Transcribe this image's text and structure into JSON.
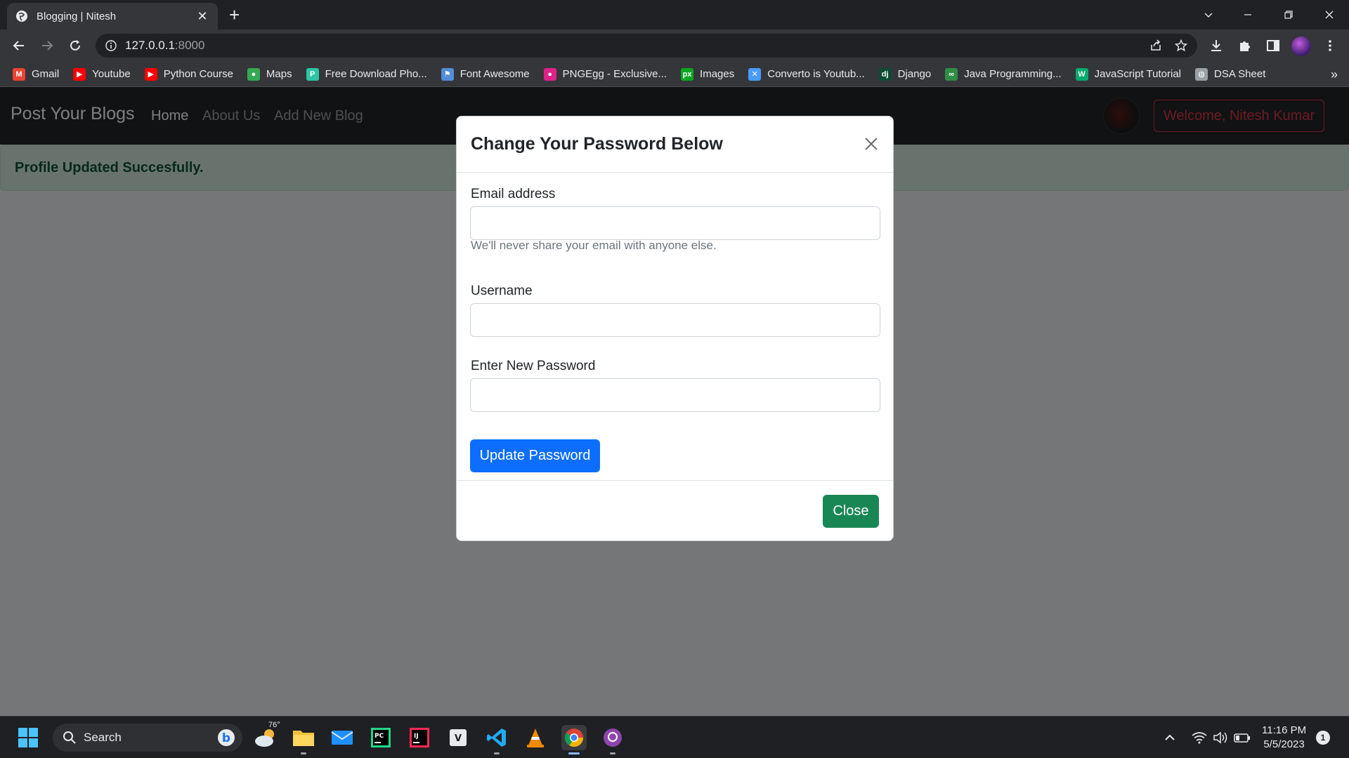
{
  "browser": {
    "tab_title": "Blogging | Nitesh",
    "url_host": "127.0.0.1",
    "url_port": ":8000",
    "bookmarks": [
      {
        "label": "Gmail",
        "icon": "gmail-icon",
        "color": "#ea4335"
      },
      {
        "label": "Youtube",
        "icon": "youtube-icon",
        "color": "#ff0000"
      },
      {
        "label": "Python Course",
        "icon": "youtube-icon",
        "color": "#ff0000"
      },
      {
        "label": "Maps",
        "icon": "maps-icon",
        "color": "#34a853"
      },
      {
        "label": "Free Download Pho...",
        "icon": "photo-site-icon",
        "color": "#2ec4a6"
      },
      {
        "label": "Font Awesome",
        "icon": "flag-icon",
        "color": "#528dd7"
      },
      {
        "label": "PNGEgg - Exclusive...",
        "icon": "pngegg-icon",
        "color": "#e0218a"
      },
      {
        "label": "Images",
        "icon": "px-icon",
        "color": "#07a81f"
      },
      {
        "label": "Converto is Youtub...",
        "icon": "converto-icon",
        "color": "#4a9bff"
      },
      {
        "label": "Django",
        "icon": "django-icon",
        "color": "#0c4b33"
      },
      {
        "label": "Java Programming...",
        "icon": "gfg-icon",
        "color": "#2f8d46"
      },
      {
        "label": "JavaScript Tutorial",
        "icon": "w3-icon",
        "color": "#04aa6d"
      },
      {
        "label": "DSA Sheet",
        "icon": "globe-icon",
        "color": "#9aa0a6"
      }
    ],
    "bookmarks_more": "»"
  },
  "navbar": {
    "brand": "Post Your Blogs",
    "links": [
      "Home",
      "About Us",
      "Add New Blog"
    ],
    "welcome": "Welcome, Nitesh Kumar"
  },
  "alert": {
    "message": "Profile Updated Succesfully."
  },
  "modal": {
    "title": "Change Your Password Below",
    "email_label": "Email address",
    "email_value": "",
    "email_help": "We'll never share your email with anyone else.",
    "username_label": "Username",
    "username_value": "",
    "password_label": "Enter New Password",
    "password_value": "",
    "submit_label": "Update Password",
    "close_label": "Close"
  },
  "taskbar": {
    "search_label": "Search",
    "weather_temp": "76°",
    "time": "11:16 PM",
    "date": "5/5/2023",
    "notification_count": "1"
  },
  "colors": {
    "primary": "#0d6efd",
    "success": "#198754",
    "danger": "#dc3545",
    "navbar_bg": "#212529",
    "alert_bg": "#d1e7dd"
  }
}
